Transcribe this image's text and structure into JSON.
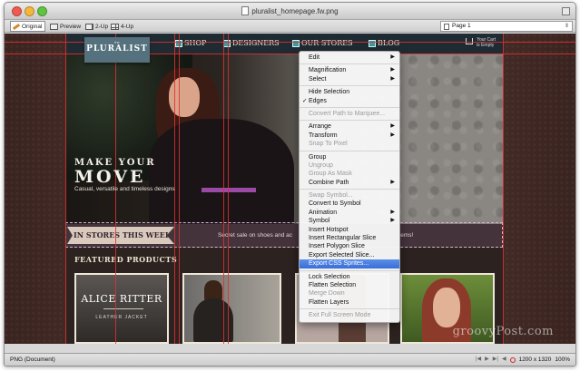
{
  "window": {
    "title": "pluralist_homepage.fw.png"
  },
  "toolbar": {
    "views": [
      {
        "label": "Original",
        "icon": "pencil-icon",
        "active": true
      },
      {
        "label": "Preview",
        "icon": "preview-icon",
        "active": false
      },
      {
        "label": "2-Up",
        "icon": "two-up-icon",
        "active": false
      },
      {
        "label": "4-Up",
        "icon": "four-up-icon",
        "active": false
      }
    ],
    "page_select": "Page 1"
  },
  "site": {
    "logo_small": "the",
    "logo": "PLURALIST",
    "nav": [
      "SHOP",
      "DESIGNERS",
      "OUR STORES",
      "BLOG"
    ],
    "cart_line1": "Your Cart",
    "cart_line2": "is Empty",
    "hero_line1": "MAKE YOUR",
    "hero_line2": "MOVE",
    "hero_line3": "Casual, versatile and timeless designs",
    "stores_tag": "IN STORES THIS WEEK",
    "stores_text": "Secret sale on shoes and ac",
    "stores_text_right": "items!",
    "featured": "FEATURED PRODUCTS",
    "product1_name": "ALICE RITTER",
    "product1_sub": "LEATHER JACKET"
  },
  "context_menu": {
    "groups": [
      [
        {
          "label": "Edit",
          "submenu": true,
          "disabled": false
        }
      ],
      [
        {
          "label": "Magnification",
          "submenu": true,
          "disabled": false
        },
        {
          "label": "Select",
          "submenu": true,
          "disabled": false
        }
      ],
      [
        {
          "label": "Hide Selection",
          "submenu": false,
          "disabled": false
        },
        {
          "label": "Edges",
          "submenu": false,
          "disabled": false,
          "checked": true
        }
      ],
      [
        {
          "label": "Convert Path to Marquee...",
          "submenu": false,
          "disabled": true
        }
      ],
      [
        {
          "label": "Arrange",
          "submenu": true,
          "disabled": false
        },
        {
          "label": "Transform",
          "submenu": true,
          "disabled": false
        },
        {
          "label": "Snap To Pixel",
          "submenu": false,
          "disabled": true
        }
      ],
      [
        {
          "label": "Group",
          "submenu": false,
          "disabled": false
        },
        {
          "label": "Ungroup",
          "submenu": false,
          "disabled": true
        },
        {
          "label": "Group As Mask",
          "submenu": false,
          "disabled": true
        },
        {
          "label": "Combine Path",
          "submenu": true,
          "disabled": false
        }
      ],
      [
        {
          "label": "Swap Symbol...",
          "submenu": false,
          "disabled": true
        },
        {
          "label": "Convert to Symbol",
          "submenu": false,
          "disabled": false
        },
        {
          "label": "Animation",
          "submenu": true,
          "disabled": false
        },
        {
          "label": "Symbol",
          "submenu": true,
          "disabled": false
        },
        {
          "label": "Insert Hotspot",
          "submenu": false,
          "disabled": false
        },
        {
          "label": "Insert Rectangular Slice",
          "submenu": false,
          "disabled": false
        },
        {
          "label": "Insert Polygon Slice",
          "submenu": false,
          "disabled": false
        },
        {
          "label": "Export Selected Slice...",
          "submenu": false,
          "disabled": false
        },
        {
          "label": "Export CSS Sprites...",
          "submenu": false,
          "disabled": false,
          "highlighted": true
        }
      ],
      [
        {
          "label": "Lock Selection",
          "submenu": false,
          "disabled": false
        },
        {
          "label": "Flatten Selection",
          "submenu": false,
          "disabled": false
        },
        {
          "label": "Merge Down",
          "submenu": false,
          "disabled": true
        },
        {
          "label": "Flatten Layers",
          "submenu": false,
          "disabled": false
        }
      ],
      [
        {
          "label": "Exit Full Screen Mode",
          "submenu": false,
          "disabled": true
        }
      ]
    ]
  },
  "status": {
    "doc_type": "PNG (Document)",
    "dimensions": "1200 x 1320",
    "zoom": "100%"
  },
  "watermark": "groovyPost.com",
  "colors": {
    "guide": "#e23030",
    "menu_highlight": "#3a6ed8"
  }
}
